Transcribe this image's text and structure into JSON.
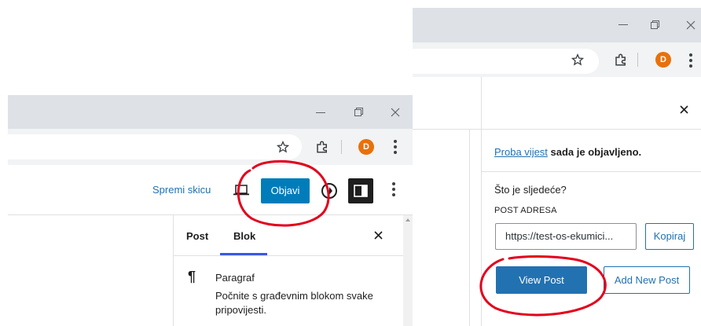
{
  "left_window": {
    "avatar_initial": "D",
    "header": {
      "save_draft": "Spremi skicu",
      "publish": "Objavi"
    },
    "sidebar": {
      "tabs": [
        "Post",
        "Blok"
      ],
      "active_tab": "Blok",
      "block_title": "Paragraf",
      "block_description_line1": "Počnite s građevnim blokom svake",
      "block_description_line2": "pripovijesti."
    }
  },
  "right_window": {
    "avatar_initial": "D",
    "published_notice": {
      "post_link": "Proba vijest",
      "suffix": " sada je objavljeno."
    },
    "whats_next": "Što je sljedeće?",
    "post_address_label": "POST ADRESA",
    "post_address_value": "https://test-os-ekumici...",
    "copy_button": "Kopiraj",
    "view_post_button": "View Post",
    "add_new_post_button": "Add New Post"
  },
  "colors": {
    "wp_blue": "#2271b1",
    "annotation_red": "#e3001b",
    "avatar_orange": "#e8710a",
    "tab_accent": "#3858e9"
  },
  "icons": [
    "minimize-icon",
    "restore-icon",
    "close-icon",
    "star-icon",
    "extensions-icon",
    "kebab-menu-icon",
    "preview-device-icon",
    "jetpack-icon",
    "sidebar-toggle-icon",
    "paragraph-icon"
  ]
}
